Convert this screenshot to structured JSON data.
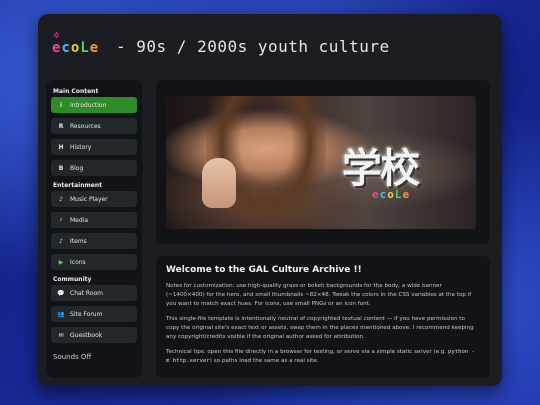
{
  "header": {
    "logo_spark": "✲",
    "logo_letters": [
      "e",
      "c",
      "o",
      "L",
      "e"
    ],
    "site_title": "- 90s / 2000s youth culture"
  },
  "sidebar": {
    "sections": [
      {
        "title": "Main Content",
        "items": [
          {
            "icon": "i",
            "icon_name": "info-icon",
            "label": "Introduction",
            "active": true
          },
          {
            "icon": "R",
            "icon_name": "resources-icon",
            "label": "Resources"
          },
          {
            "icon": "H",
            "icon_name": "history-icon",
            "label": "History"
          },
          {
            "icon": "B",
            "icon_name": "blog-icon",
            "label": "Blog"
          }
        ]
      },
      {
        "title": "Entertainment",
        "items": [
          {
            "icon": "♪",
            "icon_name": "music-note-icon",
            "label": "Music Player"
          },
          {
            "icon": "⚡",
            "icon_name": "lightning-icon",
            "label": "Media"
          },
          {
            "icon": "♪",
            "icon_name": "music-note-icon",
            "label": "Items"
          },
          {
            "icon": "▶",
            "icon_name": "play-icon",
            "label": "Icons"
          }
        ]
      },
      {
        "title": "Community",
        "items": [
          {
            "icon": "💬",
            "icon_name": "chat-bubble-icon",
            "label": "Chat Room"
          },
          {
            "icon": "👥",
            "icon_name": "people-icon",
            "label": "Site Forum"
          },
          {
            "icon": "✉",
            "icon_name": "envelope-icon",
            "label": "Guestbook"
          }
        ]
      }
    ],
    "sounds_label": "Sounds Off"
  },
  "hero": {
    "kanji": "学校",
    "logo_letters": [
      "e",
      "c",
      "o",
      "L",
      "e"
    ]
  },
  "content": {
    "heading": "Welcome to the GAL Culture Archive !!",
    "p1": "Notes for customization: use high-quality grass or bokeh backgrounds for the body, a wide banner (~1400×400) for the hero, and small thumbnails ~82×48. Tweak the colors in the CSS variables at the top if you want to match exact hues. For icons, use small PNGs or an icon font.",
    "p2": "This single-file template is intentionally neutral of copyrighted textual content — if you have permission to copy the original site's exact text or assets, swap them in the places mentioned above. I recommend keeping any copyright/credits visible if the original author asked for attribution.",
    "p3_before": "Technical tips: open this file directly in a browser for testing, or serve via a simple static server (e.g. ",
    "p3_code": "python -m http.server",
    "p3_after": ") so paths load the same as a real site."
  }
}
